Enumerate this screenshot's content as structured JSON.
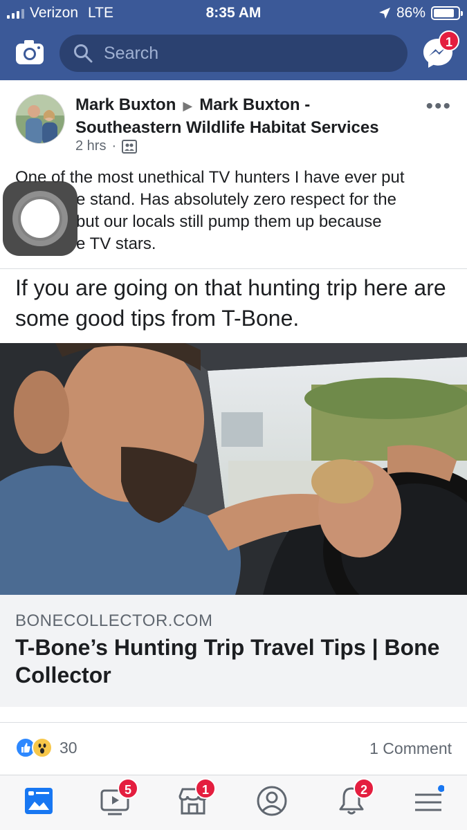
{
  "status_bar": {
    "carrier": "Verizon",
    "network": "LTE",
    "time": "8:35 AM",
    "battery": "86%",
    "battery_level": 0.86
  },
  "top_bar": {
    "search_placeholder": "Search",
    "messenger_badge": "1",
    "accent_color": "#3b5998"
  },
  "post": {
    "author": "Mark Buxton",
    "target": "Mark Buxton - Southeastern Wildlife Habitat Services",
    "time": "2 hrs",
    "text": "One of the most unethical TV hunters I have ever put … stand.  Has absolutely zero respect for the … but our locals still pump them up because … TV stars.",
    "text_lines": [
      "One of the most unethical TV hunters I have ever put",
      "e stand.  Has absolutely zero respect for the",
      "but our locals still pump them up because",
      "e TV stars."
    ],
    "shared_caption": "If you are going on that hunting trip here are some good tips from T-Bone.",
    "link": {
      "domain": "BONECOLLECTOR.COM",
      "title": "T-Bone’s Hunting Trip Travel Tips | Bone Collector"
    },
    "reaction_count": "30",
    "comment_count": "1 Comment"
  },
  "bottom_nav": {
    "items": [
      {
        "name": "news-feed",
        "badge": ""
      },
      {
        "name": "watch",
        "badge": "5"
      },
      {
        "name": "marketplace",
        "badge": "1"
      },
      {
        "name": "profile",
        "badge": ""
      },
      {
        "name": "notifications",
        "badge": "2"
      },
      {
        "name": "menu",
        "badge": ""
      }
    ]
  }
}
